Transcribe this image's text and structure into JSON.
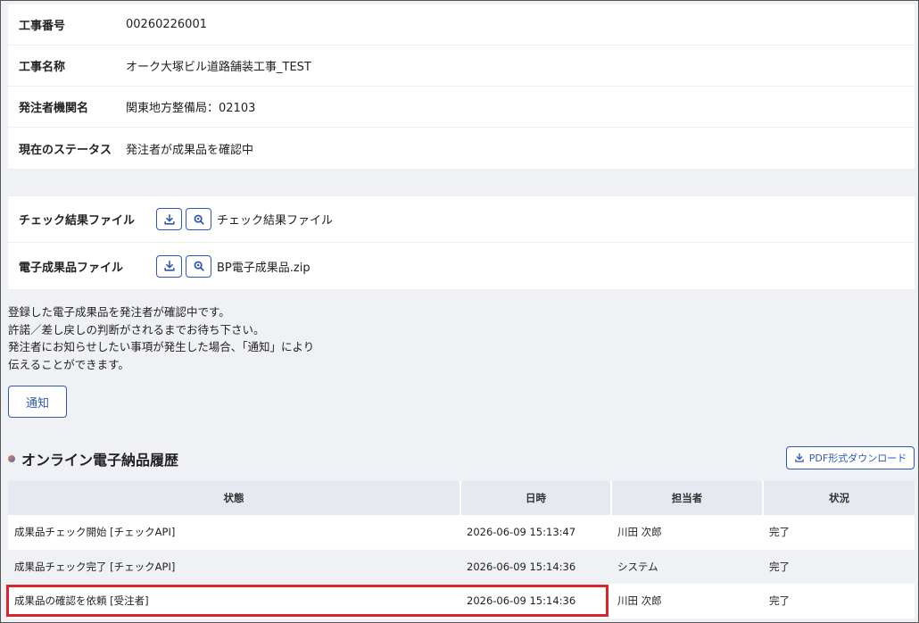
{
  "info": {
    "rows": [
      {
        "label": "工事番号",
        "value": "00260226001"
      },
      {
        "label": "工事名称",
        "value": "オーク大塚ビル道路舗装工事_TEST"
      },
      {
        "label": "発注者機関名",
        "value": "関東地方整備局：02103"
      },
      {
        "label": "現在のステータス",
        "value": "発注者が成果品を確認中"
      }
    ]
  },
  "files": {
    "rows": [
      {
        "label": "チェック結果ファイル",
        "filename": "チェック結果ファイル",
        "download_icon": "download-icon",
        "preview_icon": "zoom-icon"
      },
      {
        "label": "電子成果品ファイル",
        "filename": "BP電子成果品.zip",
        "download_icon": "download-icon",
        "preview_icon": "zoom-icon"
      }
    ]
  },
  "notice": {
    "lines": [
      "登録した電子成果品を発注者が確認中です。",
      "許諾／差し戻しの判断がされるまでお待ち下さい。",
      "発注者にお知らせしたい事項が発生した場合、「通知」により",
      "伝えることができます。"
    ]
  },
  "notify_button": {
    "label": "通知"
  },
  "history": {
    "title": "オンライン電子納品履歴",
    "pdf_button": "PDF形式ダウンロード",
    "columns": [
      "状態",
      "日時",
      "担当者",
      "状況"
    ],
    "rows": [
      {
        "state": "成果品チェック開始 [チェックAPI]",
        "datetime": "2026-06-09 15:13:47",
        "person": "川田 次郎",
        "status": "完了"
      },
      {
        "state": "成果品チェック完了 [チェックAPI]",
        "datetime": "2026-06-09 15:14:36",
        "person": "システム",
        "status": "完了"
      },
      {
        "state": "成果品の確認を依頼 [受注者]",
        "datetime": "2026-06-09 15:14:36",
        "person": "川田 次郎",
        "status": "完了"
      }
    ]
  },
  "colors": {
    "accent": "#2f58b5",
    "highlight": "#d9262c",
    "header_bg": "#e6e9f0",
    "page_bg": "#f0f1f5"
  }
}
